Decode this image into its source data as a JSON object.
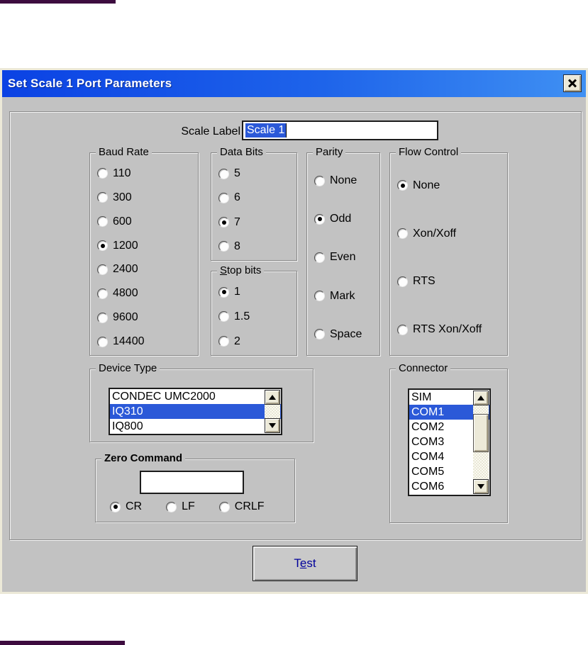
{
  "window": {
    "title": "Set Scale 1 Port Parameters"
  },
  "scale_label": {
    "label": "Scale Label",
    "value": "Scale 1"
  },
  "groups": {
    "baud_rate": {
      "title": "Baud Rate",
      "options": [
        "110",
        "300",
        "600",
        "1200",
        "2400",
        "4800",
        "9600",
        "14400"
      ],
      "selected": "1200"
    },
    "data_bits": {
      "title": "Data Bits",
      "options": [
        "5",
        "6",
        "7",
        "8"
      ],
      "selected": "7"
    },
    "stop_bits": {
      "title_accel": "S",
      "title_rest": "top bits",
      "options": [
        "1",
        "1.5",
        "2"
      ],
      "selected": "1"
    },
    "parity": {
      "title": "Parity",
      "options": [
        "None",
        "Odd",
        "Even",
        "Mark",
        "Space"
      ],
      "selected": "Odd"
    },
    "flow_control": {
      "title": "Flow Control",
      "options": [
        "None",
        "Xon/Xoff",
        "RTS",
        "RTS Xon/Xoff"
      ],
      "selected": "None"
    },
    "device_type": {
      "title": "Device Type",
      "items": [
        "CONDEC UMC2000",
        "IQ310",
        "IQ800"
      ],
      "selected": "IQ310"
    },
    "zero_command": {
      "title": "Zero Command",
      "value": "",
      "options": [
        "CR",
        "LF",
        "CRLF"
      ],
      "selected": "CR"
    },
    "connector": {
      "title": "Connector",
      "items": [
        "SIM",
        "COM1",
        "COM2",
        "COM3",
        "COM4",
        "COM5",
        "COM6"
      ],
      "selected": "COM1"
    }
  },
  "buttons": {
    "test": {
      "pre": "T",
      "accel": "e",
      "post": "st"
    }
  },
  "colors": {
    "titlebar_left": "#0b42e4",
    "titlebar_right": "#3f90f3",
    "dialog_bg": "#c2c2c2",
    "dialog_frame": "#ece9d8",
    "selection": "#2b59d8",
    "test_text": "#00009b",
    "rule_fragment": "#3d0c3f"
  }
}
